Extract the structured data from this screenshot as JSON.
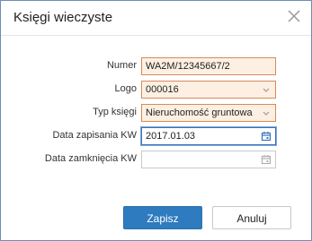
{
  "dialog": {
    "title": "Księgi wieczyste"
  },
  "form": {
    "numer": {
      "label": "Numer",
      "value": "WA2M/12345667/2"
    },
    "logo": {
      "label": "Logo",
      "value": "000016"
    },
    "typ_ksiegi": {
      "label": "Typ księgi",
      "value": "Nieruchomość gruntowa"
    },
    "data_zapisania": {
      "label": "Data zapisania KW",
      "value": "2017.01.03"
    },
    "data_zamkniecia": {
      "label": "Data zamknięcia KW",
      "value": ""
    }
  },
  "buttons": {
    "primary_label": "Zapisz",
    "secondary_label": "Anuluj"
  },
  "colors": {
    "primary": "#2e7bbf",
    "highlight_bg": "#fdf0e2",
    "highlight_border": "#d48a5a",
    "focus_border": "#3a74b8"
  },
  "icons": {
    "close": "close-icon",
    "dropdown": "chevron-down-icon",
    "calendar": "calendar-icon"
  }
}
